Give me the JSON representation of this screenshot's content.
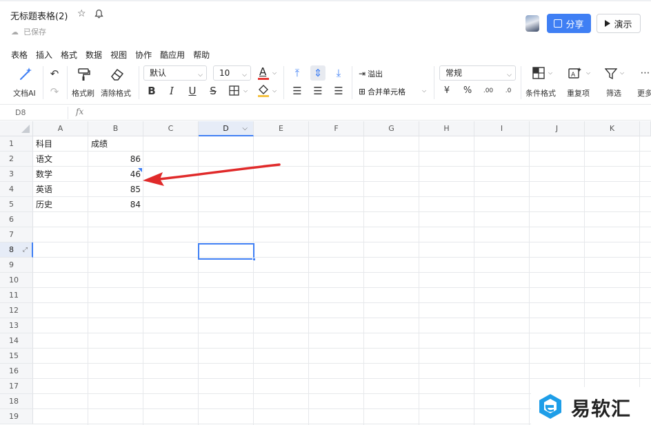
{
  "title_bar": {
    "doc_title": "无标题表格(2)",
    "saved_status": "已保存",
    "share_label": "分享",
    "present_label": "演示"
  },
  "menu": [
    "表格",
    "插入",
    "格式",
    "数据",
    "视图",
    "协作",
    "酷应用",
    "帮助"
  ],
  "toolbar": {
    "ai_label": "文档AI",
    "format_painter_label": "格式刷",
    "clear_format_label": "清除格式",
    "font_name": "默认",
    "font_size": "10",
    "overflow_label": "溢出",
    "merge_label": "合并单元格",
    "number_format": "常规",
    "currency_symbol": "¥",
    "percent_symbol": "%",
    "cond_format_label": "条件格式",
    "duplicates_label": "重复项",
    "filter_label": "筛选",
    "more_label": "更多",
    "bold": "B",
    "italic": "I",
    "underline": "U",
    "strike": "S",
    "font_color_letter": "A",
    "colors": {
      "font_color_bar": "#e53935",
      "fill_color_bar": "#f5c242",
      "accent": "#3f7ff4"
    }
  },
  "formula_bar": {
    "cell_ref": "D8",
    "fx": "fx"
  },
  "sheet": {
    "columns": [
      "A",
      "B",
      "C",
      "D",
      "E",
      "F",
      "G",
      "H",
      "I",
      "J",
      "K"
    ],
    "selected_column": "D",
    "selected_row": "8",
    "rows": [
      "1",
      "2",
      "3",
      "4",
      "5",
      "6",
      "7",
      "8",
      "9",
      "10",
      "11",
      "12",
      "13",
      "14",
      "15",
      "16",
      "17",
      "18",
      "19"
    ],
    "cells": [
      {
        "a": "科目",
        "b": "成绩"
      },
      {
        "a": "语文",
        "b": "86"
      },
      {
        "a": "数学",
        "b": "46"
      },
      {
        "a": "英语",
        "b": "85"
      },
      {
        "a": "历史",
        "b": "84"
      }
    ]
  },
  "watermark": {
    "text": "易软汇"
  }
}
